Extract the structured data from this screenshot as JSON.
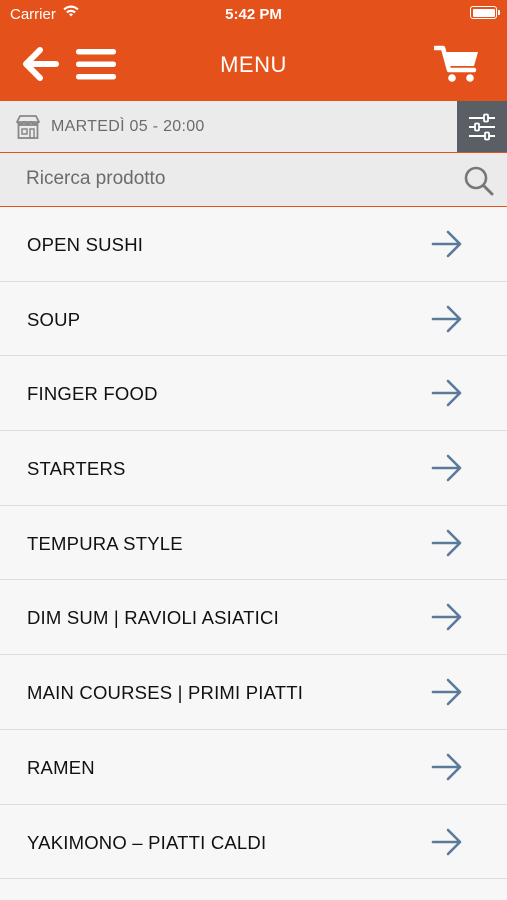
{
  "status_bar": {
    "carrier": "Carrier",
    "time": "5:42 PM"
  },
  "header": {
    "title": "MENU",
    "background_color": "#e5511a",
    "icons": [
      "back-arrow-icon",
      "hamburger-icon",
      "cart-icon"
    ]
  },
  "date_bar": {
    "text": "MARTEDÌ 05 - 20:00",
    "icon": "store-icon",
    "filter_icon": "sliders-icon"
  },
  "search": {
    "placeholder": "Ricerca prodotto",
    "value": ""
  },
  "categories": [
    {
      "label": "OPEN SUSHI"
    },
    {
      "label": "SOUP"
    },
    {
      "label": "FINGER FOOD"
    },
    {
      "label": "STARTERS"
    },
    {
      "label": "TEMPURA STYLE"
    },
    {
      "label": "DIM SUM | RAVIOLI ASIATICI"
    },
    {
      "label": "MAIN COURSES | PRIMI PIATTI"
    },
    {
      "label": "RAMEN"
    },
    {
      "label": "YAKIMONO – PIATTI CALDI"
    }
  ],
  "colors": {
    "accent": "#e5511a",
    "arrow": "#5b7a9a",
    "filter_button": "#5a5f66"
  }
}
